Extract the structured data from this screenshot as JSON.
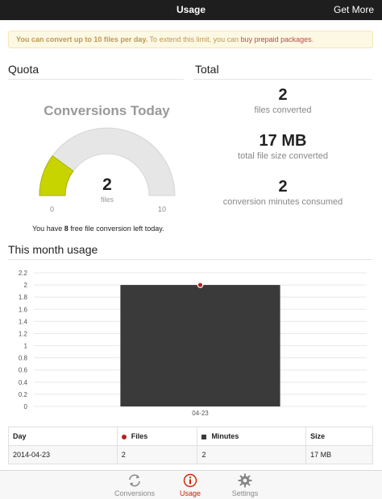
{
  "topbar": {
    "title": "Usage",
    "get_more": "Get More"
  },
  "notice": {
    "bold_text": "You can convert up to 10 files per day.",
    "text": " To extend this limit, you can ",
    "link": "buy prepaid packages",
    "end": "."
  },
  "quota": {
    "heading": "Quota",
    "gauge_title": "Conversions Today",
    "value": "2",
    "unit": "files",
    "min": "0",
    "max": "10",
    "level": 0.2,
    "remaining_prefix": "You have ",
    "remaining_count": "8",
    "remaining_suffix": " free file conversion left today.",
    "colors": {
      "fill": "#c8d400",
      "track": "#e6e6e6"
    }
  },
  "total": {
    "heading": "Total",
    "stats": [
      {
        "value": "2",
        "label": "files converted"
      },
      {
        "value": "17 MB",
        "label": "total file size converted"
      },
      {
        "value": "2",
        "label": "conversion minutes consumed"
      }
    ]
  },
  "month": {
    "heading": "This month usage"
  },
  "chart_data": {
    "type": "bar",
    "categories": [
      "04-23"
    ],
    "series": [
      {
        "name": "Files",
        "values": [
          2
        ],
        "kind": "line",
        "color": "#b22222"
      },
      {
        "name": "Minutes",
        "values": [
          2
        ],
        "kind": "bar",
        "color": "#3a3a3a"
      }
    ],
    "yticks": [
      "0",
      "0.2",
      "0.4",
      "0.6",
      "0.8",
      "1",
      "1.2",
      "1.4",
      "1.6",
      "1.8",
      "2",
      "2.2"
    ],
    "ylim": [
      0,
      2.2
    ],
    "grid": true
  },
  "table": {
    "headers": [
      "Day",
      "Files",
      "Minutes",
      "Size"
    ],
    "rows": [
      [
        "2014-04-23",
        "2",
        "2",
        "17 MB"
      ]
    ],
    "colors": {
      "files": "#b22222",
      "minutes": "#3a3a3a"
    }
  },
  "tabs": [
    {
      "label": "Conversions",
      "icon": "refresh-icon",
      "color": "#888888"
    },
    {
      "label": "Usage",
      "icon": "info-icon",
      "color": "#cc2200"
    },
    {
      "label": "Settings",
      "icon": "gear-icon",
      "color": "#888888"
    }
  ]
}
